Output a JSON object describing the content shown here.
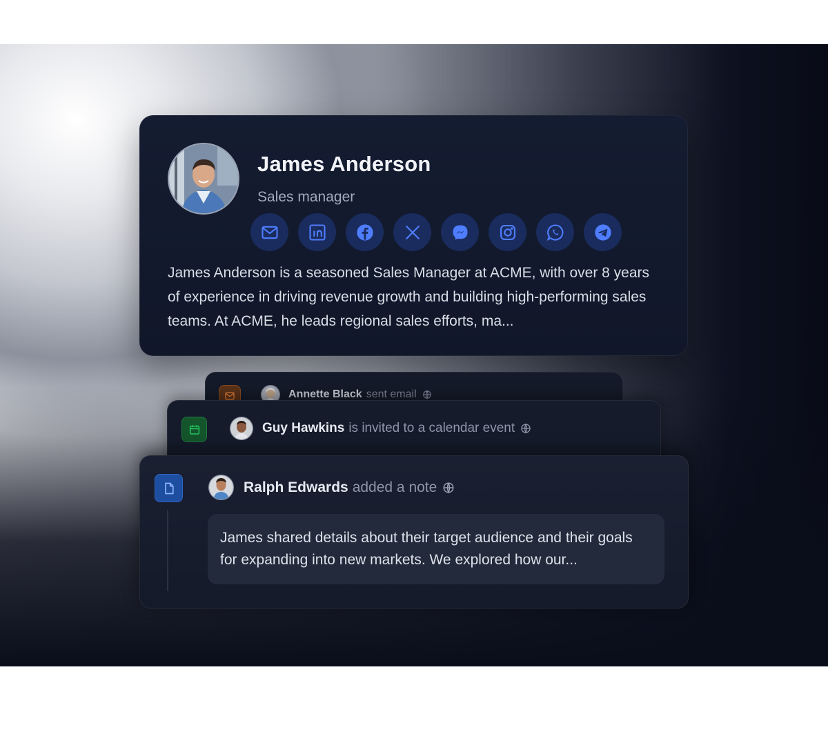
{
  "profile": {
    "name": "James Anderson",
    "role": "Sales manager",
    "bio": "James Anderson is a seasoned Sales Manager at ACME, with over 8 years of experience in driving revenue growth and building high-performing sales teams. At ACME, he leads regional sales efforts, ma...",
    "socials": [
      {
        "name": "email-icon"
      },
      {
        "name": "linkedin-icon"
      },
      {
        "name": "facebook-icon"
      },
      {
        "name": "x-icon"
      },
      {
        "name": "messenger-icon"
      },
      {
        "name": "instagram-icon"
      },
      {
        "name": "whatsapp-icon"
      },
      {
        "name": "telegram-icon"
      }
    ]
  },
  "activities": [
    {
      "actor": "Annette Black",
      "action": "sent email",
      "type_icon": "mail-icon",
      "color": "#c0652a"
    },
    {
      "actor": "Guy Hawkins",
      "action": "is invited to a calendar event",
      "type_icon": "calendar-icon",
      "color": "#22c55e"
    },
    {
      "actor": "Ralph Edwards",
      "action": "added a note",
      "type_icon": "note-icon",
      "color": "#3b82f6",
      "note": "James shared details about their target audience and their goals for expanding into new markets. We explored how our..."
    }
  ],
  "colors": {
    "accent": "#4f7dff",
    "card": "#141c31"
  }
}
